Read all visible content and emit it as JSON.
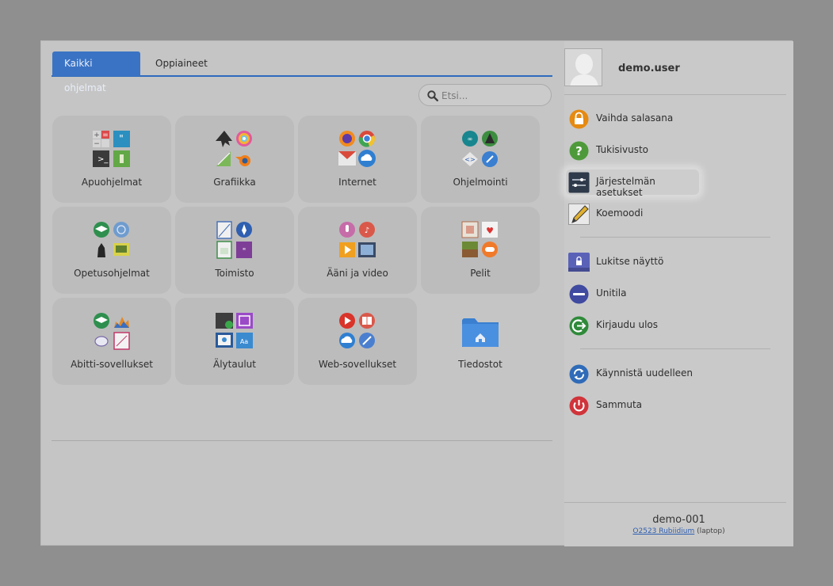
{
  "tabs": {
    "all": "Kaikki ohjelmat",
    "subjects": "Oppiaineet"
  },
  "search": {
    "placeholder": "Etsi..."
  },
  "categories": [
    {
      "label": "Apuohjelmat",
      "icon": "accessories-icon"
    },
    {
      "label": "Grafiikka",
      "icon": "graphics-icon"
    },
    {
      "label": "Internet",
      "icon": "internet-icon"
    },
    {
      "label": "Ohjelmointi",
      "icon": "programming-icon"
    },
    {
      "label": "Opetusohjelmat",
      "icon": "education-icon"
    },
    {
      "label": "Toimisto",
      "icon": "office-icon"
    },
    {
      "label": "Ääni ja video",
      "icon": "audio-video-icon"
    },
    {
      "label": "Pelit",
      "icon": "games-icon"
    },
    {
      "label": "Abitti-sovellukset",
      "icon": "abitti-apps-icon"
    },
    {
      "label": "Älytaulut",
      "icon": "smartboards-icon"
    },
    {
      "label": "Web-sovellukset",
      "icon": "web-apps-icon"
    },
    {
      "label": "Tiedostot",
      "icon": "files-folder-icon"
    }
  ],
  "user": {
    "name": "demo.user"
  },
  "menu": [
    {
      "label": "Vaihda salasana",
      "icon": "lock-icon"
    },
    {
      "label": "Tukisivusto",
      "icon": "help-icon"
    },
    {
      "label": "Järjestelmän asetukset",
      "icon": "settings-sliders-icon"
    },
    {
      "label": "Koemoodi",
      "icon": "pencil-icon"
    },
    {
      "label": "Lukitse näyttö",
      "icon": "lock-screen-icon"
    },
    {
      "label": "Unitila",
      "icon": "sleep-icon"
    },
    {
      "label": "Kirjaudu ulos",
      "icon": "logout-icon"
    },
    {
      "label": "Käynnistä uudelleen",
      "icon": "restart-icon"
    },
    {
      "label": "Sammuta",
      "icon": "power-icon"
    }
  ],
  "host": {
    "name": "demo-001",
    "model": "O2523 Rubiidium",
    "type": "(laptop)"
  },
  "colors": {
    "accent": "#3a73c4",
    "overlay": "#8f8f8f",
    "panel": "#c5c5c5"
  }
}
